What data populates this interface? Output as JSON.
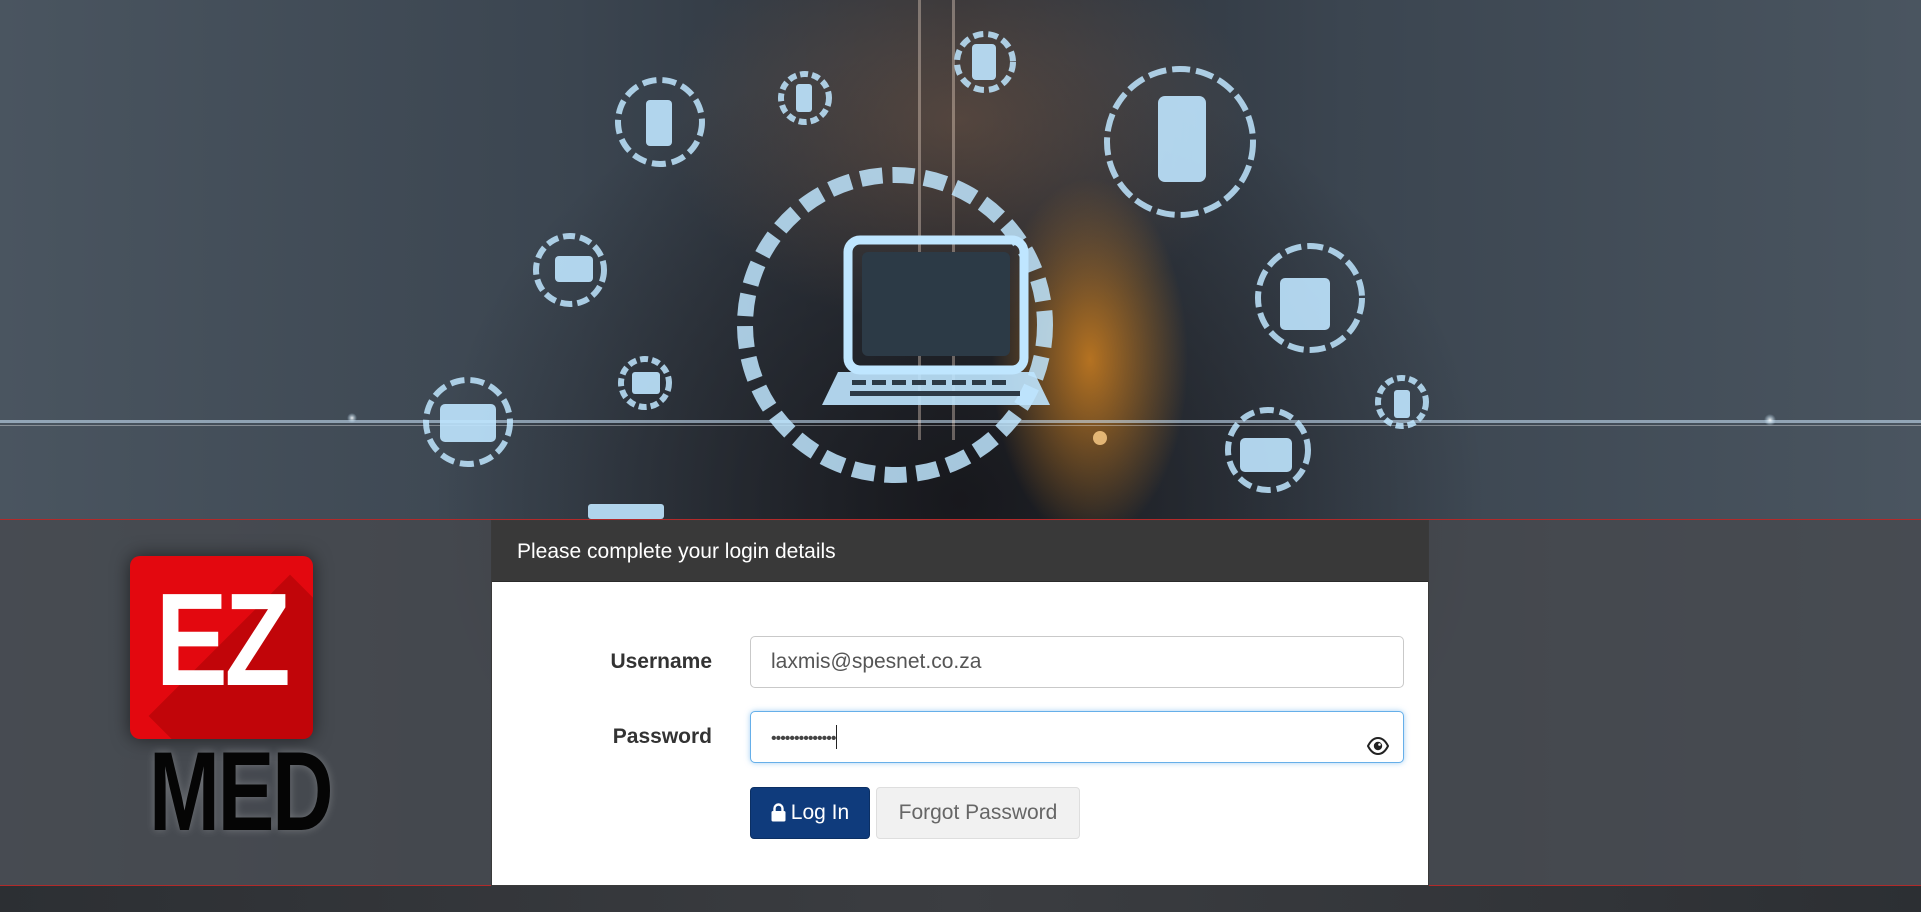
{
  "login": {
    "heading": "Please complete your login details",
    "username_label": "Username",
    "username_value": "laxmis@spesnet.co.za",
    "password_label": "Password",
    "password_masked": "••••••••••••••",
    "login_button": "Log In",
    "forgot_button": "Forgot Password"
  },
  "logo": {
    "top_text": "EZ",
    "bottom_text": "MED"
  },
  "icons": {
    "lock": "lock-icon",
    "eye": "eye-icon"
  },
  "colors": {
    "header_bg": "#393939",
    "login_button": "#0f3b7c",
    "logo_red": "#e3080f",
    "band_border": "#b22a2a",
    "focus_border": "#66afe9"
  }
}
